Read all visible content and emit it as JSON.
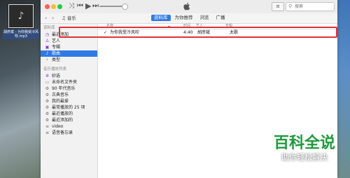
{
  "desktop": {
    "file_label": "胡彦斌 - 为你我受冷风吹.mp3"
  },
  "toolbar": {
    "search_placeholder": "搜索"
  },
  "nav": {
    "media": "♫ 音乐",
    "tabs": [
      "资料库",
      "为你推荐",
      "浏览",
      "广播"
    ],
    "active_tab": "资料库"
  },
  "sidebar": {
    "library_header": "资料库",
    "library_items": [
      "最近添加",
      "艺人",
      "专辑",
      "歌曲",
      "类型"
    ],
    "playlist_header": "音乐播放列表",
    "playlist_items": [
      "妙选",
      "未命名文件夹",
      "90 年代音乐",
      "古典音乐",
      "我的最爱",
      "最常播放的 25 项",
      "最近播放的",
      "最近添加的",
      "video",
      "语音备忘录"
    ]
  },
  "table": {
    "headers": [
      "名称",
      "时间",
      "艺人",
      "专辑"
    ],
    "rows": [
      {
        "check": "✓",
        "name": "为你我受冷风吹",
        "time": "4:40",
        "artist": "胡彦斌",
        "album": "太歌"
      }
    ]
  },
  "watermark": {
    "title": "百科全说",
    "subtitle": "助你轻松解决"
  }
}
